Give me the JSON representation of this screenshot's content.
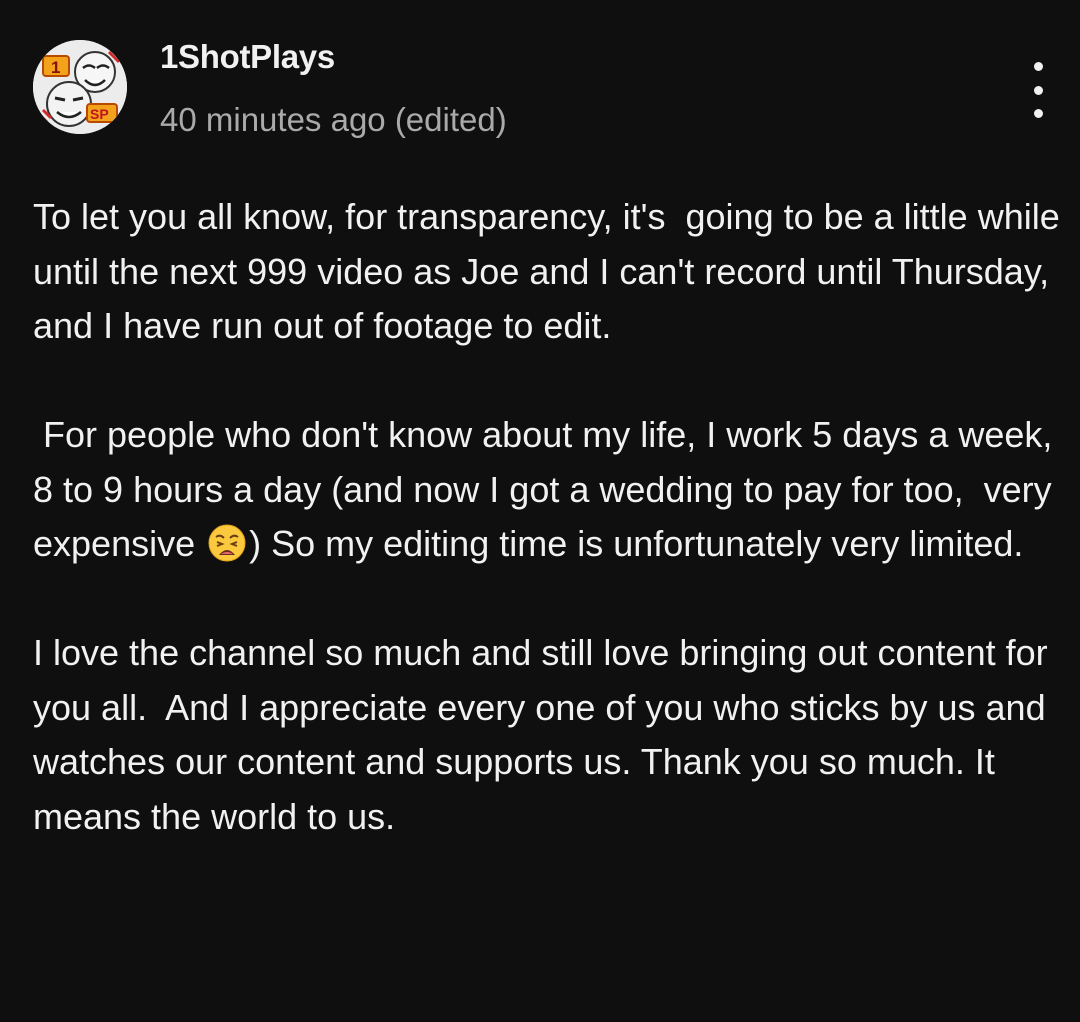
{
  "post": {
    "author": "1ShotPlays",
    "timestamp": "40 minutes ago (edited)",
    "avatar_badges": {
      "number": "1",
      "initials": "SP"
    },
    "menu_icon": "more-vertical-icon",
    "paragraph1": "To let you all know, for transparency, it's  going to be a little while until the next 999 video as Joe and I can't record until Thursday, and I have run out of footage to edit.",
    "paragraph2_before_emoji": " For people who don't know about my life, I work 5 days a week, 8 to 9 hours a day (and now I got a wedding to pay for too,  very expensive ",
    "emoji": "weary-face-emoji",
    "paragraph2_after_emoji": ") So my editing time is unfortunately very limited.",
    "paragraph3": "I love the channel so much and still love bringing out content for you all.  And I appreciate every one of you who sticks by us and watches our content and supports us. Thank you so much. It means the world to us."
  },
  "colors": {
    "background": "#0f0f0f",
    "primary_text": "#f1f1f1",
    "secondary_text": "#aaaaaa"
  }
}
